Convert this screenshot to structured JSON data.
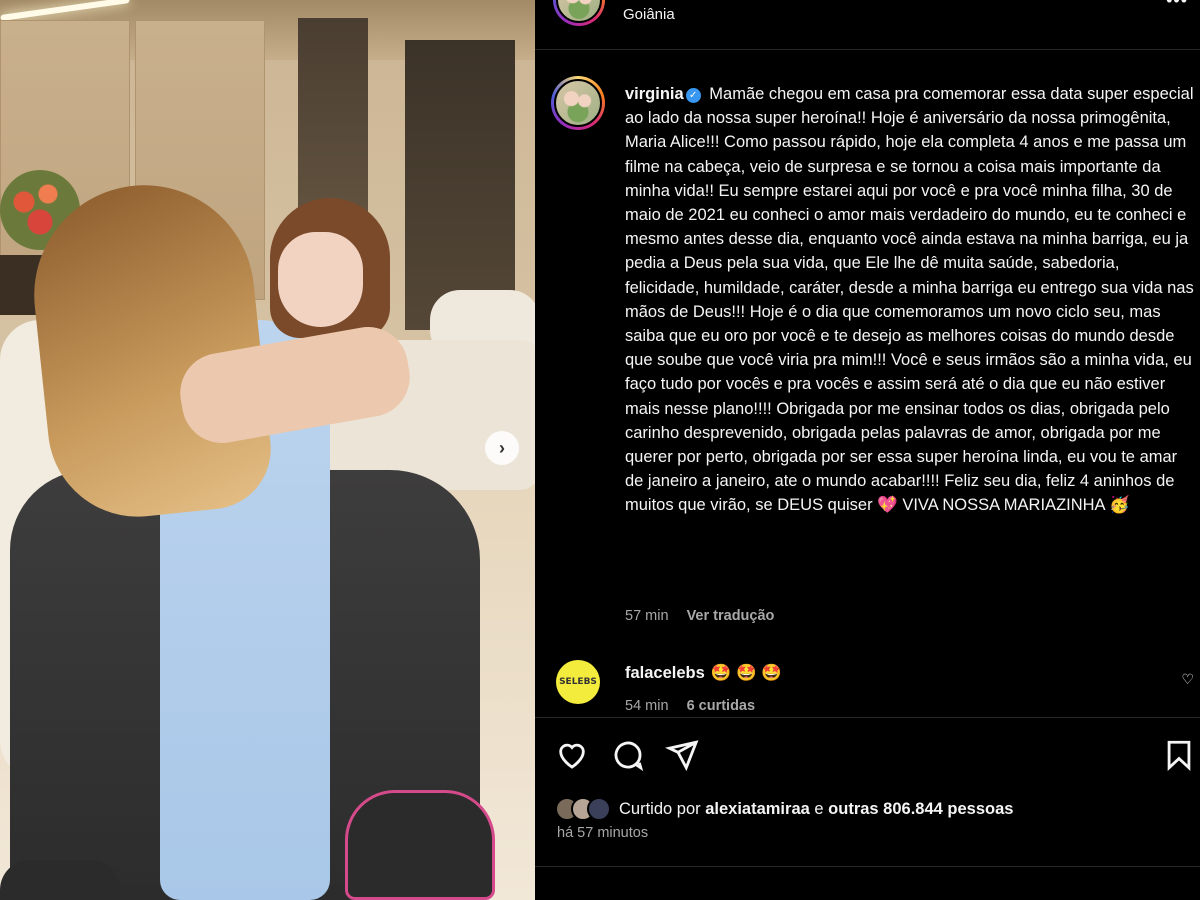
{
  "post": {
    "location": "Goiânia",
    "more_icon": "more-dots-icon"
  },
  "caption": {
    "username": "virginia",
    "text": "Mamãe chegou em casa pra comemorar essa data super especial ao lado da nossa super heroína!! Hoje é aniversário da nossa primogênita, Maria Alice!!! Como passou rápido, hoje ela completa 4 anos e me passa um filme na cabeça, veio de surpresa e se tornou a coisa mais importante da minha vida!! Eu sempre estarei aqui por você e pra você minha filha, 30 de maio de 2021 eu conheci o amor mais verdadeiro do mundo, eu te conheci e mesmo antes desse dia, enquanto você ainda estava na minha barriga, eu ja pedia a Deus pela sua vida, que Ele lhe dê muita saúde, sabedoria, felicidade, humildade, caráter, desde a minha barriga eu entrego sua vida nas mãos de Deus!!! Hoje é o dia que comemoramos um novo ciclo seu, mas saiba que eu oro por você e te desejo as melhores coisas do mundo desde que soube que você viria pra mim!!! Você e seus irmãos são a minha vida, eu faço tudo por vocês e pra vocês e assim será até o dia que eu não estiver mais nesse plano!!!! Obrigada por me ensinar todos os dias, obrigada pelo carinho desprevenido, obrigada pelas palavras de amor, obrigada por me querer por perto, obrigada por ser essa super heroína linda, eu vou te amar de janeiro a janeiro, ate o mundo acabar!!!! Feliz seu dia, feliz 4 aninhos de muitos que virão, se DEUS quiser 💖 VIVA NOSSA MARIAZINHA 🥳",
    "time": "57 min",
    "translate_label": "Ver tradução"
  },
  "comment": {
    "avatar_text": "SELEBS",
    "username": "falacelebs",
    "text": "🤩 🤩 🤩",
    "time": "54 min",
    "likes": "6 curtidas"
  },
  "likes": {
    "prefix": "Curtido por",
    "first_user": "alexiatamiraa",
    "connector": "e",
    "others": "outras 806.844 pessoas"
  },
  "timestamp": "há 57 minutos",
  "icons": [
    "next-arrow-icon",
    "heart-icon",
    "comment-icon",
    "share-icon",
    "bookmark-icon"
  ],
  "colors": {
    "background": "#000000",
    "text": "#f5f5f5",
    "secondary_text": "#a8a8a8",
    "verified": "#3897f0",
    "divider": "#262626"
  }
}
